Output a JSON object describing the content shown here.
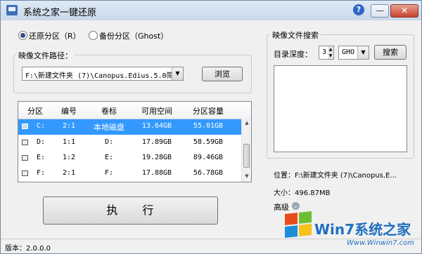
{
  "window": {
    "title": "系统之家一键还原"
  },
  "titlebar_buttons": {
    "help": "?",
    "minimize": "—",
    "maximize": "□",
    "close": "✕"
  },
  "mode": {
    "restore_label": "还原分区（R）",
    "backup_label": "备份分区（Ghost）",
    "selected": "restore"
  },
  "image_path": {
    "label": "映像文件路径：",
    "value": "F:\\新建文件夹 (7)\\Canopus.Edius.5.0简",
    "browse_label": "浏览"
  },
  "table": {
    "headers": [
      "分区",
      "编号",
      "卷标",
      "可用空间",
      "分区容量"
    ],
    "rows": [
      {
        "drive": "C:",
        "num": "2:1",
        "label": "本地磁盘",
        "free": "13.64GB",
        "size": "55.01GB",
        "selected": true
      },
      {
        "drive": "D:",
        "num": "1:1",
        "label": "D:",
        "free": "17.89GB",
        "size": "58.59GB",
        "selected": false
      },
      {
        "drive": "E:",
        "num": "1:2",
        "label": "E:",
        "free": "19.28GB",
        "size": "89.46GB",
        "selected": false
      },
      {
        "drive": "F:",
        "num": "2:1",
        "label": "F:",
        "free": "17.88GB",
        "size": "56.78GB",
        "selected": false
      }
    ]
  },
  "execute": {
    "label": "执　　行"
  },
  "search": {
    "title": "映像文件搜索",
    "depth_label": "目录深度：",
    "depth_value": "3",
    "type_value": "GHO",
    "search_label": "搜索"
  },
  "info": {
    "location": "位置：F:\\新建文件夹 (7)\\Canopus.E...",
    "size": "大小：496.87MB",
    "advanced_label": "高级"
  },
  "status": {
    "version": "版本：2.0.0.0"
  },
  "watermark": {
    "brand": "Win7系统之家",
    "url": "Www.Winwin7.com"
  }
}
